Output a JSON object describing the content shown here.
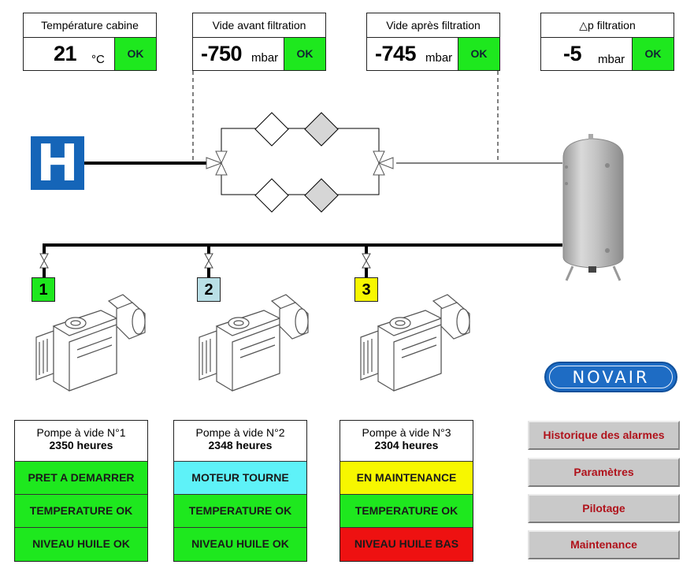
{
  "measurements": [
    {
      "id": "temperature-cabine",
      "title": "Température cabine",
      "value": "21",
      "unit": "°C",
      "status": "OK"
    },
    {
      "id": "vide-avant-filtration",
      "title": "Vide avant filtration",
      "value": "-750",
      "unit": "mbar",
      "status": "OK"
    },
    {
      "id": "vide-apres-filtration",
      "title": "Vide après filtration",
      "value": "-745",
      "unit": "mbar",
      "status": "OK"
    },
    {
      "id": "delta-p-filtration",
      "title": "△p filtration",
      "value": "-5",
      "unit": "mbar",
      "status": "OK"
    }
  ],
  "diagram": {
    "source_icon": "H",
    "source_icon_name": "hospital-icon",
    "tank_name": "vacuum-tank",
    "filter_lines": 2
  },
  "pumps": [
    {
      "number": "1",
      "color": "#1ee81e",
      "name": "Pompe à vide N°1",
      "hours": "2350 heures",
      "states": [
        {
          "label": "PRET A DEMARRER",
          "color": "#1ee81e"
        },
        {
          "label": "TEMPERATURE OK",
          "color": "#1ee81e"
        },
        {
          "label": "NIVEAU HUILE OK",
          "color": "#1ee81e"
        }
      ]
    },
    {
      "number": "2",
      "color": "#b9dfe6",
      "name": "Pompe à vide N°2",
      "hours": "2348 heures",
      "states": [
        {
          "label": "MOTEUR TOURNE",
          "color": "#5ef2f8"
        },
        {
          "label": "TEMPERATURE OK",
          "color": "#1ee81e"
        },
        {
          "label": "NIVEAU HUILE OK",
          "color": "#1ee81e"
        }
      ]
    },
    {
      "number": "3",
      "color": "#f7f700",
      "name": "Pompe à vide N°3",
      "hours": "2304 heures",
      "states": [
        {
          "label": "EN MAINTENANCE",
          "color": "#f7f700"
        },
        {
          "label": "TEMPERATURE OK",
          "color": "#1ee81e"
        },
        {
          "label": "NIVEAU HUILE BAS",
          "color": "#ee1111"
        }
      ]
    }
  ],
  "logo": {
    "text": "NOVAIR",
    "color": "#1e6cc4"
  },
  "nav": {
    "buttons": [
      {
        "label": "Historique des alarmes"
      },
      {
        "label": "Paramètres"
      },
      {
        "label": "Pilotage"
      },
      {
        "label": "Maintenance"
      }
    ]
  },
  "colors": {
    "ok_green": "#1ee81e",
    "running_cyan": "#5ef2f8",
    "maintenance_yellow": "#f7f700",
    "alarm_red": "#ee1111",
    "button_text": "#b0121b"
  }
}
